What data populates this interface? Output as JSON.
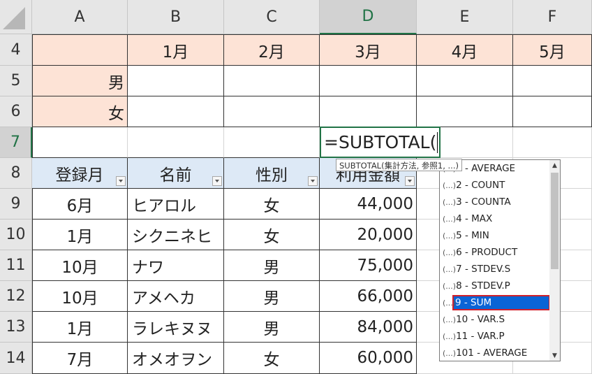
{
  "columns": [
    "A",
    "B",
    "C",
    "D",
    "E",
    "F"
  ],
  "active_column": "D",
  "active_row": "7",
  "rows": [
    "4",
    "5",
    "6",
    "7",
    "8",
    "9",
    "10",
    "11",
    "12",
    "13",
    "14"
  ],
  "row4": {
    "b": "1月",
    "c": "2月",
    "d": "3月",
    "e": "4月",
    "f": "5月"
  },
  "row5": {
    "a": "男"
  },
  "row6": {
    "a": "女"
  },
  "headers": {
    "a": "登録月",
    "b": "名前",
    "c": "性別",
    "d": "利用金額"
  },
  "data_rows": [
    {
      "month": "6月",
      "name": "ヒアロル",
      "gender": "女",
      "amount": "44,000"
    },
    {
      "month": "1月",
      "name": "シクニネヒ",
      "gender": "女",
      "amount": "20,000"
    },
    {
      "month": "10月",
      "name": "ナワ",
      "gender": "男",
      "amount": "75,000"
    },
    {
      "month": "10月",
      "name": "アメヘカ",
      "gender": "男",
      "amount": "66,000"
    },
    {
      "month": "1月",
      "name": "ラレキヌヌ",
      "gender": "男",
      "amount": "84,000"
    },
    {
      "month": "7月",
      "name": "オメオヲン",
      "gender": "女",
      "amount": "60,000"
    }
  ],
  "formula": "=SUBTOTAL(",
  "tooltip": "SUBTOTAL(集計方法, 参照1, ...)",
  "autocomplete": {
    "icon_glyph": "(...)",
    "items": [
      "1 - AVERAGE",
      "2 - COUNT",
      "3 - COUNTA",
      "4 - MAX",
      "5 - MIN",
      "6 - PRODUCT",
      "7 - STDEV.S",
      "8 - STDEV.P",
      "9 - SUM",
      "10 - VAR.S",
      "11 - VAR.P",
      "101 - AVERAGE"
    ],
    "selected_index": 8
  },
  "colors": {
    "accent": "#217346",
    "salmon": "#fde3d6",
    "blue": "#dde9f6",
    "selection": "#0a64d6",
    "highlight_border": "#d0202a"
  }
}
